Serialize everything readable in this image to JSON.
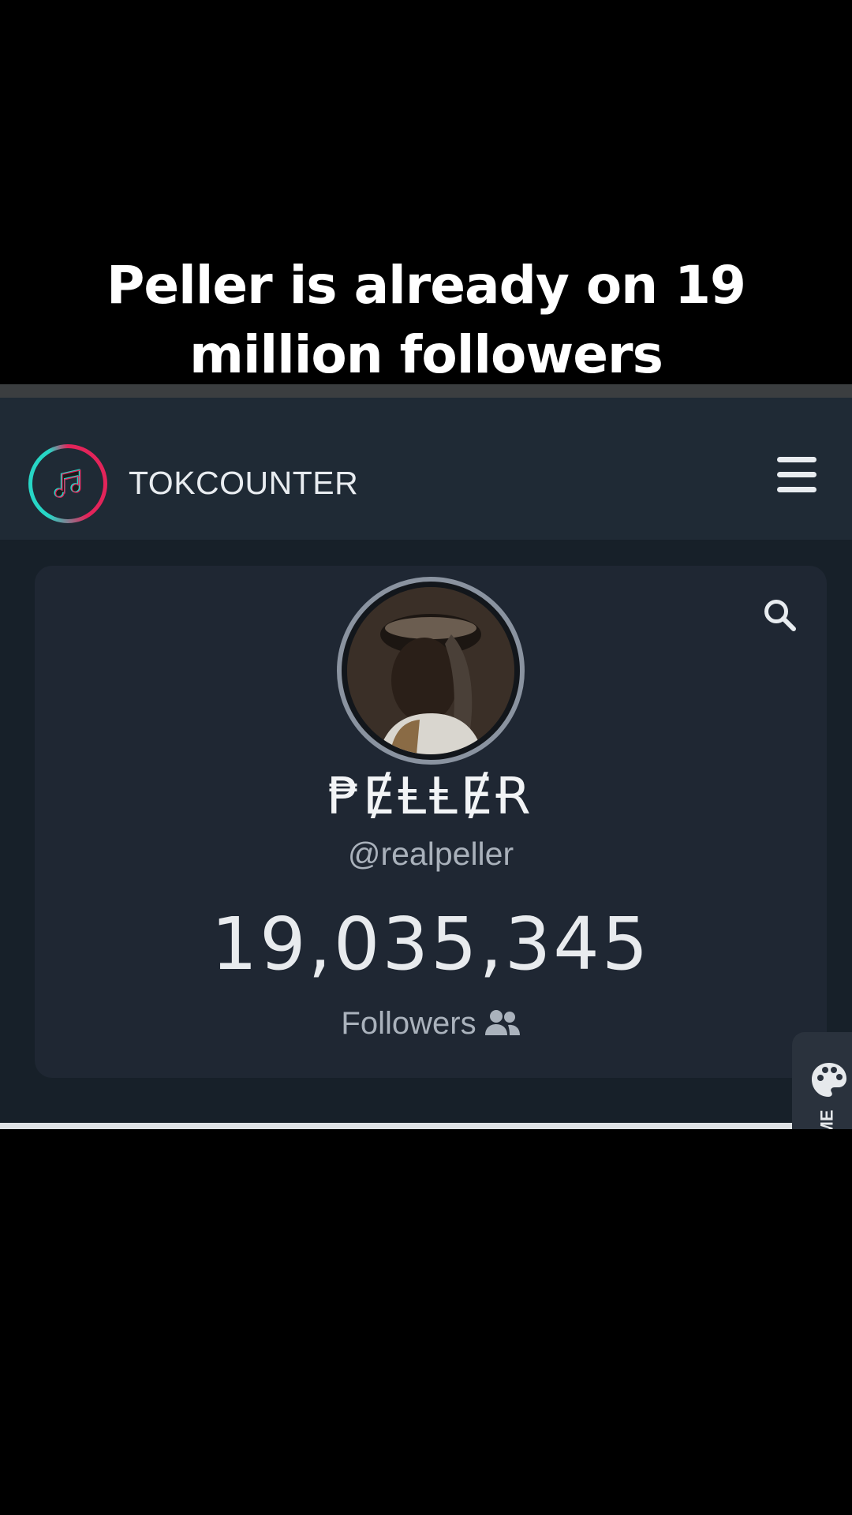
{
  "caption": {
    "line1": "Peller is already on 19",
    "line2": "million followers"
  },
  "nav": {
    "brand": "TOKCOUNTER",
    "logo_icon": "music-note-icon",
    "menu_icon": "hamburger-menu-icon"
  },
  "profile": {
    "display_name": "₱ɆⱠⱠɆɌ",
    "handle": "@realpeller",
    "follower_count": "19,035,345",
    "follower_label": "Followers",
    "follower_icon": "users-icon",
    "search_icon": "search-icon"
  },
  "theme_tab": {
    "label": "ME",
    "icon": "palette-icon"
  },
  "colors": {
    "background": "#000000",
    "nav_bg": "#1f2a35",
    "card_bg": "#1f2733",
    "accent_pink": "#e3245a",
    "accent_cyan": "#27d6c6"
  }
}
